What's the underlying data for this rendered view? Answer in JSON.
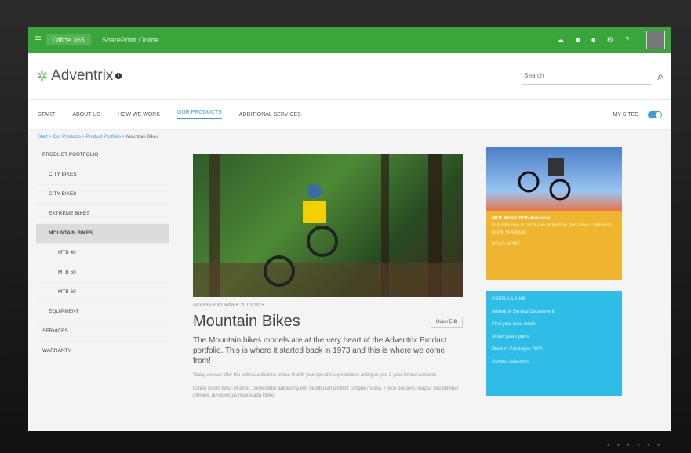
{
  "topbar": {
    "app_label": "Office 365",
    "site_label": "SharePoint Online"
  },
  "header": {
    "logo_text": "Adventrix",
    "search_placeholder": "Search"
  },
  "nav": {
    "items": [
      "START",
      "ABOUT US",
      "HOW WE WORK",
      "OUR PRODUCTS",
      "ADDITIONAL SERVICES"
    ],
    "right_label": "MY SITES"
  },
  "breadcrumb": {
    "items": [
      "Start",
      "Our Products",
      "Product Portfolio"
    ],
    "current": "Mountain Bikes"
  },
  "sidebar": {
    "items": [
      {
        "label": "PRODUCT PORTFOLIO",
        "level": 1
      },
      {
        "label": "CITY BIKES",
        "level": 2
      },
      {
        "label": "CITY BIKES",
        "level": 2
      },
      {
        "label": "EXTREME BIKES",
        "level": 2
      },
      {
        "label": "MOUNTAIN BIKES",
        "level": 2,
        "selected": true
      },
      {
        "label": "MTB 40",
        "level": 3
      },
      {
        "label": "MTB 50",
        "level": 3
      },
      {
        "label": "MTB 60",
        "level": 3
      },
      {
        "label": "EQUIPMENT",
        "level": 2
      },
      {
        "label": "SERVICES",
        "level": 1
      },
      {
        "label": "WARRANTY",
        "level": 1
      }
    ]
  },
  "article": {
    "meta": "ADVENTRIX OWNER   20.03.2015",
    "title": "Mountain Bikes",
    "quick_edit": "Quick Edit",
    "lead": "The Mountain bikes models are at the very heart of the Adventrix Product portfolio. This is where it started back in 1973 and this is where we come from!",
    "body1": "Today we can offer the enthusiastic bike prices that fit your specific expectations and give you 2-year limited warranty.",
    "body2": "Lorem ipsum dolor sit amet, consectetur adipiscing elit, Vestibulum porttitor congue massa. Fusce posuere, magna sed pulvinar ultricies, purus lectus malesuada libero."
  },
  "promo_card": {
    "title": "MTB Model 2015 Available",
    "text": "Our new bike is here! Pre-order now and have it delivered to you in August.",
    "link": "READ MORE"
  },
  "links_card": {
    "title": "USEFUL LINKS",
    "items": [
      "Adventrix Service Department",
      "Find your local dealer",
      "Order spare parts",
      "Product Catalogue 2015",
      "Contact Adventrix"
    ]
  }
}
